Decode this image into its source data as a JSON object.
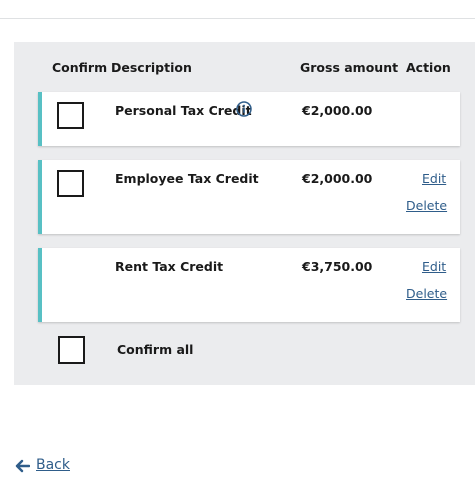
{
  "table": {
    "headers": {
      "confirm": "Confirm",
      "description": "Description",
      "gross_amount": "Gross amount",
      "action": "Action"
    },
    "rows": [
      {
        "description": "Personal Tax Credit",
        "amount": "€2,000.00",
        "has_checkbox": true,
        "has_info_icon": true,
        "actions": []
      },
      {
        "description": "Employee Tax Credit",
        "amount": "€2,000.00",
        "has_checkbox": true,
        "has_info_icon": false,
        "actions": [
          "Edit",
          "Delete"
        ]
      },
      {
        "description": "Rent Tax Credit",
        "amount": "€3,750.00",
        "has_checkbox": false,
        "has_info_icon": false,
        "actions": [
          "Edit",
          "Delete"
        ]
      }
    ],
    "confirm_all_label": "Confirm all"
  },
  "navigation": {
    "back_label": "Back",
    "back_icon": "arrow-left-icon",
    "info_icon": "info-icon"
  },
  "colors": {
    "accent_border": "#58c0c4",
    "link": "#2f5d8a",
    "panel_bg": "#ebecee"
  }
}
